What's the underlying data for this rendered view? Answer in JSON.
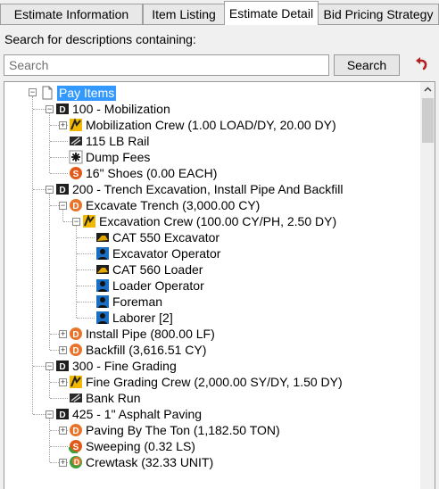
{
  "tabs": [
    {
      "label": "Estimate Information",
      "active": false
    },
    {
      "label": "Item Listing",
      "active": false
    },
    {
      "label": "Estimate Detail",
      "active": true
    },
    {
      "label": "Bid Pricing Strategy",
      "active": false
    }
  ],
  "search": {
    "label": "Search for descriptions containing:",
    "placeholder": "Search",
    "value": "",
    "button_label": "Search"
  },
  "tree": {
    "root": "Pay Items",
    "items": [
      {
        "text": "100 - Mobilization",
        "icon": "pay-item-icon"
      },
      {
        "text": "Mobilization Crew (1.00 LOAD/DY, 20.00 DY)",
        "icon": "crew-icon"
      },
      {
        "text": "115 LB Rail",
        "icon": "material-icon"
      },
      {
        "text": "Dump Fees",
        "icon": "misc-cost-icon"
      },
      {
        "text": "16\" Shoes (0.00 EACH)",
        "icon": "subcontract-icon"
      },
      {
        "text": "200 - Trench Excavation, Install Pipe And Backfill",
        "icon": "pay-item-icon"
      },
      {
        "text": "Excavate Trench (3,000.00 CY)",
        "icon": "detail-icon"
      },
      {
        "text": "Excavation Crew (100.00 CY/PH, 2.50 DY)",
        "icon": "crew-icon"
      },
      {
        "text": "CAT 550 Excavator",
        "icon": "equipment-icon"
      },
      {
        "text": "Excavator Operator",
        "icon": "labor-icon"
      },
      {
        "text": "CAT 560 Loader",
        "icon": "equipment-icon"
      },
      {
        "text": "Loader Operator",
        "icon": "labor-icon"
      },
      {
        "text": "Foreman",
        "icon": "labor-icon"
      },
      {
        "text": "Laborer [2]",
        "icon": "labor-icon"
      },
      {
        "text": "Install Pipe (800.00 LF)",
        "icon": "detail-icon"
      },
      {
        "text": "Backfill (3,616.51 CY)",
        "icon": "detail-icon"
      },
      {
        "text": "300 - Fine Grading",
        "icon": "pay-item-icon"
      },
      {
        "text": "Fine Grading Crew (2,000.00 SY/DY, 1.50 DY)",
        "icon": "crew-icon"
      },
      {
        "text": "Bank Run",
        "icon": "material-icon"
      },
      {
        "text": "425 - 1\" Asphalt Paving",
        "icon": "pay-item-icon"
      },
      {
        "text": "Paving By The Ton (1,182.50 TON)",
        "icon": "detail-icon"
      },
      {
        "text": "Sweeping (0.32 LS)",
        "icon": "subcontract-green-icon"
      },
      {
        "text": "Crewtask (32.33 UNIT)",
        "icon": "crewtask-icon"
      }
    ]
  },
  "colors": {
    "selection": "#3399ff",
    "pay_item_icon": "#1f1f1f",
    "detail_icon": "#e8742a",
    "crew_icon": "#f2b800",
    "labor_icon": "#1a6fc4",
    "equipment_icon": "#e6a800",
    "subcontract_icon": "#e05a1a",
    "undo_icon": "#b32020"
  }
}
